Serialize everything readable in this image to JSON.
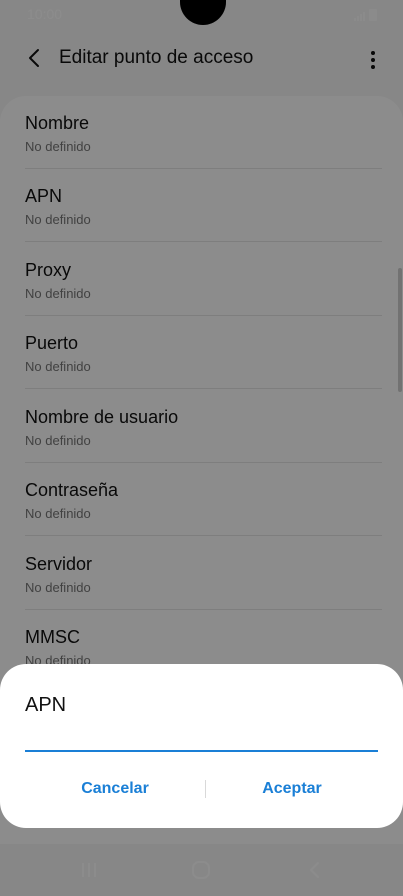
{
  "status_bar": {
    "time": "10:00"
  },
  "header": {
    "title": "Editar punto de acceso"
  },
  "list": {
    "items": [
      {
        "title": "Nombre",
        "subtitle": "No definido"
      },
      {
        "title": "APN",
        "subtitle": "No definido"
      },
      {
        "title": "Proxy",
        "subtitle": "No definido"
      },
      {
        "title": "Puerto",
        "subtitle": "No definido"
      },
      {
        "title": "Nombre de usuario",
        "subtitle": "No definido"
      },
      {
        "title": "Contraseña",
        "subtitle": "No definido"
      },
      {
        "title": "Servidor",
        "subtitle": "No definido"
      },
      {
        "title": "MMSC",
        "subtitle": "No definido"
      }
    ]
  },
  "dialog": {
    "title": "APN",
    "input_value": "",
    "cancel_label": "Cancelar",
    "ok_label": "Aceptar"
  },
  "colors": {
    "accent": "#1a7fd6",
    "overlay": "#000000"
  },
  "icons": {
    "back": "chevron-left-icon",
    "more": "more-vertical-icon",
    "recents": "recents-icon",
    "home": "home-icon",
    "nav_back": "nav-back-icon"
  }
}
